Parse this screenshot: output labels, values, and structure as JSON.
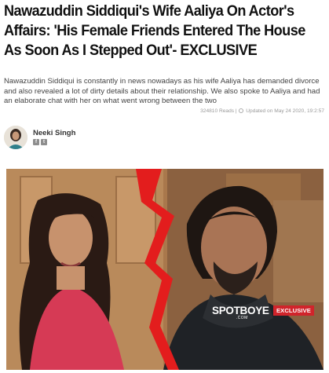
{
  "article": {
    "headline": "Nawazuddin Siddiqui's Wife Aaliya On Actor's Affairs: 'His Female Friends Entered The House As Soon As I Stepped Out'- EXCLUSIVE",
    "summary": "Nawazuddin Siddiqui is constantly in news nowadays as his wife Aaliya has demanded divorce and also revealed a lot of dirty details about their relationship. We also spoke to Aaliya and had an elaborate chat with her on what went wrong between the two",
    "reads": "324810 Reads |",
    "updated": "Updated on May 24 2020, 19:2:57"
  },
  "author": {
    "name": "Neeki Singh"
  },
  "image": {
    "watermark": "SPOTBOYE",
    "watermark_sub": ".COM",
    "badge": "EXCLUSIVE"
  },
  "colors": {
    "badge": "#d0242b",
    "tear": "#e31d1d"
  }
}
